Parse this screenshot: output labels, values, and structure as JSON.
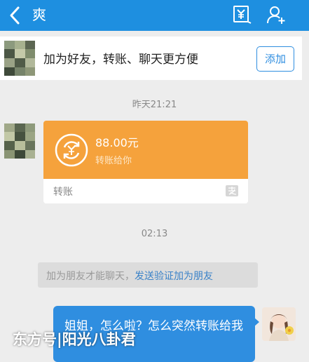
{
  "header": {
    "title": "爽",
    "back_icon": "chevron-left-icon",
    "transfer_icon": "yuan-transfer-icon",
    "add_friend_icon": "add-friend-icon"
  },
  "banner": {
    "text": "加为好友，转账、聊天更方便",
    "add_label": "添加"
  },
  "messages": {
    "timestamp_1": "昨天21:21",
    "transfer": {
      "amount": "88.00元",
      "subtitle": "转账给你",
      "label": "转账",
      "logo_icon": "alipay-logo-icon"
    },
    "timestamp_2": "02:13",
    "notice": {
      "text": "加为朋友才能聊天，",
      "link": "发送验证加为朋友"
    },
    "my_message": "姐姐，怎么啦？怎么突然转账给我"
  },
  "watermark": "东方号|阳光八卦君",
  "colors": {
    "header": "#1e8fe0",
    "transfer_card": "#f5a23c",
    "my_bubble": "#2f8ee0",
    "link": "#3a82c8"
  }
}
